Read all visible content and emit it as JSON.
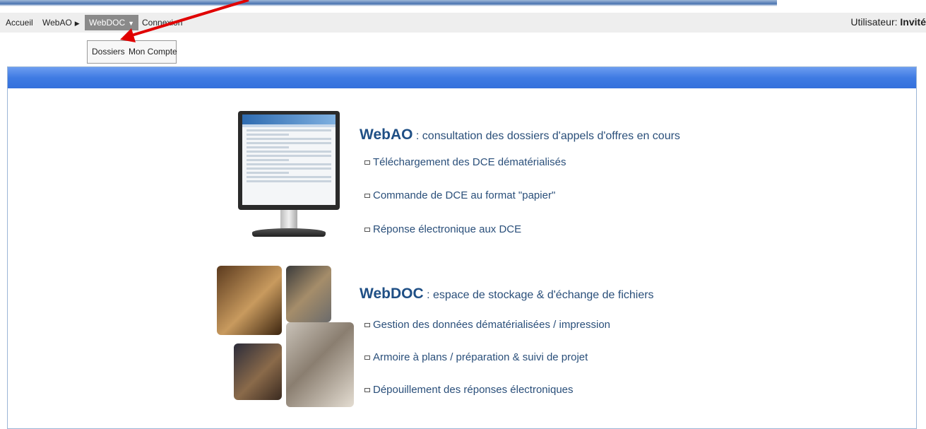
{
  "navbar": {
    "items": [
      {
        "label": "Accueil"
      },
      {
        "label": "WebAO",
        "caret": "▶"
      },
      {
        "label": "WebDOC",
        "caret": "▼"
      },
      {
        "label": "Connexion"
      }
    ],
    "user_label": "Utilisateur:",
    "user_value": "Invité"
  },
  "submenu": {
    "items": [
      {
        "label": "Dossiers"
      },
      {
        "label": "Mon Compte"
      }
    ]
  },
  "sections": [
    {
      "brand": "WebAO",
      "desc": " : consultation des dossiers d'appels d'offres en cours",
      "features": [
        "Téléchargement des DCE dématérialisés",
        "Commande de DCE au format \"papier\"",
        "Réponse électronique aux DCE"
      ]
    },
    {
      "brand": "WebDOC",
      "desc": " : espace de stockage & d'échange de fichiers",
      "features": [
        "Gestion des données dématérialisées / impression",
        "Armoire à plans / préparation & suivi de projet",
        "Dépouillement des réponses électroniques"
      ]
    }
  ],
  "colors": {
    "content_bar": "#3f7be3",
    "brand_text": "#1f4f85",
    "arrow": "#e00000"
  }
}
